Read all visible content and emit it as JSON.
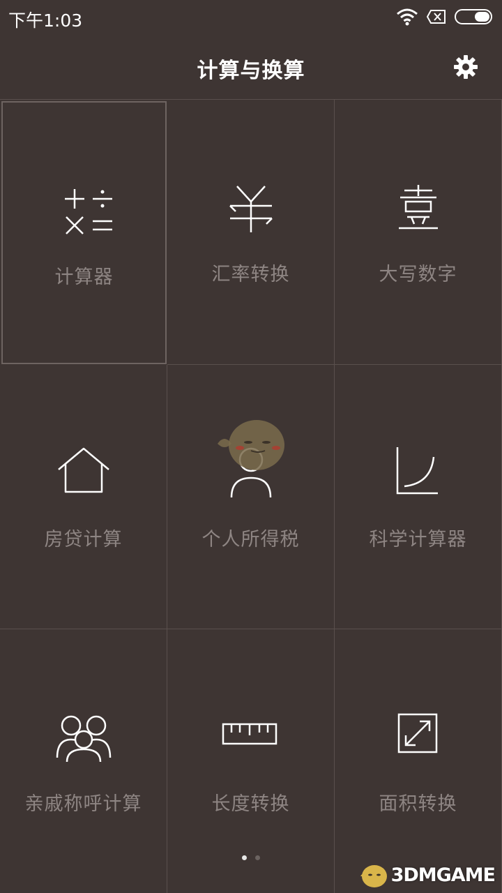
{
  "status_bar": {
    "time": "下午1:03",
    "icons": [
      "wifi-icon",
      "sim-missing-icon",
      "battery-icon"
    ]
  },
  "header": {
    "title": "计算与换算",
    "settings_icon": "gear-icon"
  },
  "tiles": [
    {
      "label": "计算器",
      "icon": "calculator-icon",
      "selected": true
    },
    {
      "label": "汇率转换",
      "icon": "currency-icon"
    },
    {
      "label": "大写数字",
      "icon": "chinese-numeral-icon"
    },
    {
      "label": "房贷计算",
      "icon": "house-icon"
    },
    {
      "label": "个人所得税",
      "icon": "person-icon"
    },
    {
      "label": "科学计算器",
      "icon": "curve-chart-icon"
    },
    {
      "label": "亲戚称呼计算",
      "icon": "family-icon"
    },
    {
      "label": "长度转换",
      "icon": "ruler-icon"
    },
    {
      "label": "面积转换",
      "icon": "resize-icon"
    }
  ],
  "pagination": {
    "pages": 2,
    "current": 1
  },
  "watermark": {
    "text": "3DMGAME"
  },
  "colors": {
    "background": "#3e3533",
    "label": "#8e8583",
    "divider": "#5a504d",
    "icon": "#ffffff"
  }
}
